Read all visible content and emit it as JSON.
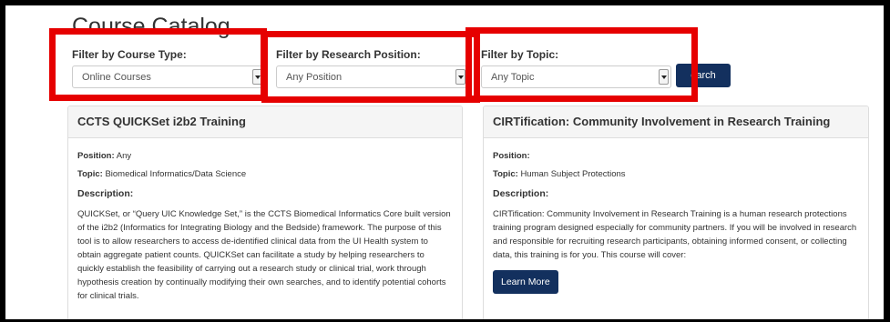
{
  "page_title": "Course Catalog",
  "filters": [
    {
      "label": "Filter by Course Type:",
      "value": "Online Courses"
    },
    {
      "label": "Filter by Research Position:",
      "value": "Any Position"
    },
    {
      "label": "Filter by Topic:",
      "value": "Any Topic"
    }
  ],
  "search_button": "Search",
  "search_button_visible": "earch",
  "courses": [
    {
      "title": "CCTS QUICKSet i2b2 Training",
      "position_label": "Position:",
      "position_value": "Any",
      "topic_label": "Topic:",
      "topic_value": "Biomedical Informatics/Data Science",
      "description_label": "Description:",
      "description": "QUICKSet, or “Query UIC Knowledge Set,” is the CCTS Biomedical Informatics Core built version of the i2b2 (Informatics for Integrating Biology and the Bedside) framework. The purpose of this tool is to allow researchers to access de-identified clinical data from the UI Health system to obtain aggregate patient counts. QUICKSet can facilitate a study by helping researchers to quickly establish the feasibility of carrying out a research study or clinical trial, work through hypothesis creation by continually modifying their own searches, and to identify potential cohorts for clinical trials."
    },
    {
      "title": "CIRTification: Community Involvement in Research Training",
      "position_label": "Position:",
      "position_value": "",
      "topic_label": "Topic:",
      "topic_value": "Human Subject Protections",
      "description_label": "Description:",
      "description": "CIRTification: Community Involvement in Research Training is a human research protections training program designed especially for community partners. If you will be involved in research and responsible for recruiting research participants, obtaining informed consent, or collecting data, this training is for you.  This course will cover:",
      "button": "Learn More"
    }
  ],
  "colors": {
    "highlight_box": "#e60000",
    "primary_button": "#13305e"
  }
}
